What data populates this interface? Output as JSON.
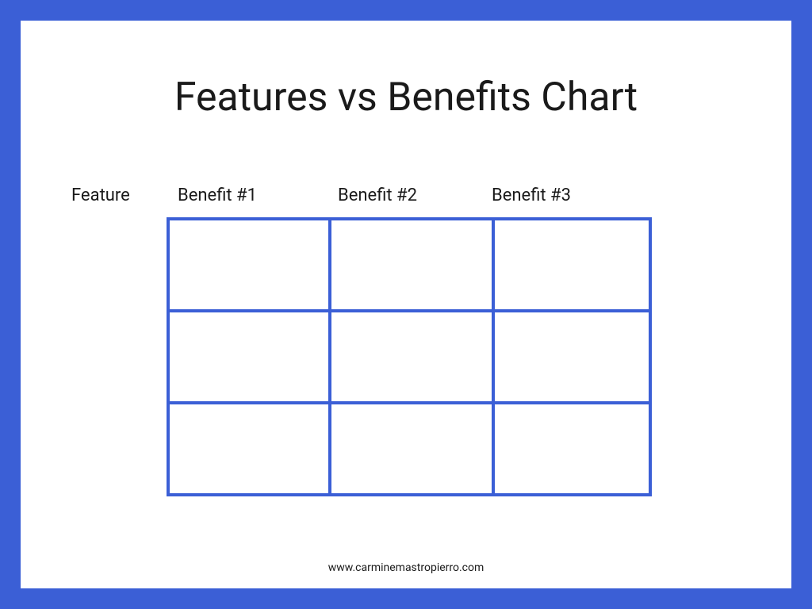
{
  "title": "Features vs Benefits Chart",
  "headers": {
    "feature": "Feature",
    "benefit1": "Benefit #1",
    "benefit2": "Benefit #2",
    "benefit3": "Benefit #3"
  },
  "footer": "www.carminemastropierro.com",
  "chart_data": {
    "type": "table",
    "title": "Features vs Benefits Chart",
    "columns": [
      "Feature",
      "Benefit #1",
      "Benefit #2",
      "Benefit #3"
    ],
    "rows": [
      [
        "",
        "",
        "",
        ""
      ],
      [
        "",
        "",
        "",
        ""
      ],
      [
        "",
        "",
        "",
        ""
      ]
    ],
    "colors": {
      "border": "#3b5fd6",
      "background": "#ffffff"
    }
  }
}
